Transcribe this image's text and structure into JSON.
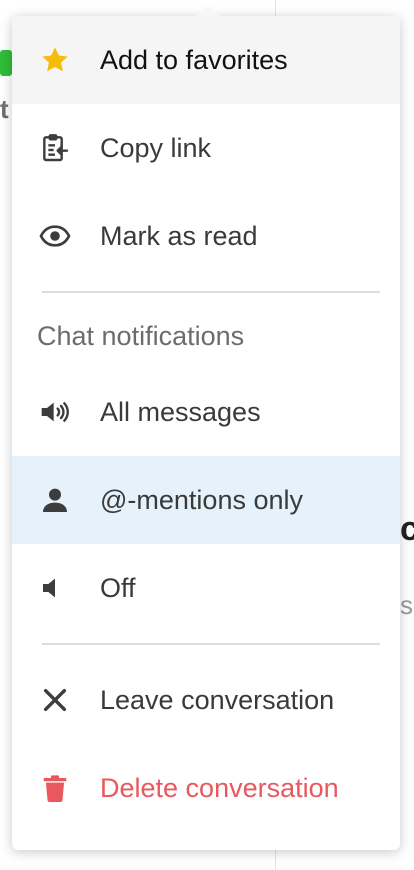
{
  "menu": {
    "items_top": [
      {
        "label": "Add to favorites",
        "icon": "star-icon"
      },
      {
        "label": "Copy link",
        "icon": "clipboard-icon"
      },
      {
        "label": "Mark as read",
        "icon": "eye-icon"
      }
    ],
    "notifications": {
      "caption": "Chat notifications",
      "options": [
        {
          "label": "All messages",
          "icon": "speaker-loud-icon"
        },
        {
          "label": "@-mentions only",
          "icon": "user-icon",
          "selected": true
        },
        {
          "label": "Off",
          "icon": "speaker-off-icon"
        }
      ]
    },
    "items_bottom": [
      {
        "label": "Leave conversation",
        "icon": "close-icon"
      },
      {
        "label": "Delete conversation",
        "icon": "trash-icon"
      }
    ]
  },
  "colors": {
    "star": "#f5bd0a",
    "danger": "#e9585e",
    "selected_bg": "#e6f2fb",
    "hover_bg": "#f5f5f5",
    "icon": "#3d3d3d"
  }
}
